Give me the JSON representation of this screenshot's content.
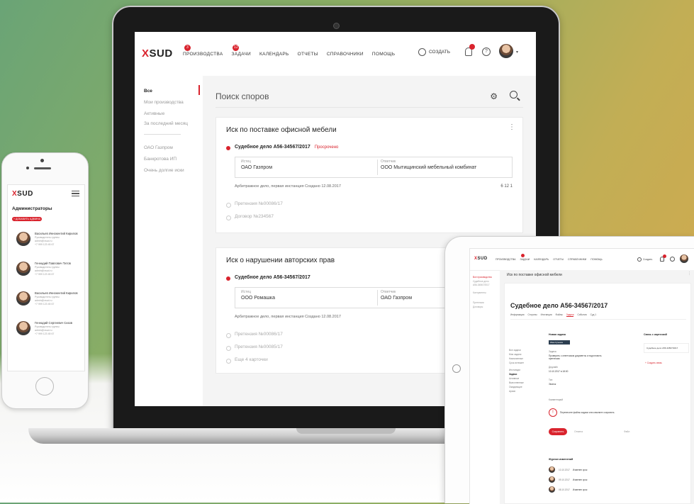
{
  "brand": {
    "logo_x": "X",
    "logo_rest": "SUD",
    "accent": "#d9232d"
  },
  "laptop": {
    "nav": [
      {
        "label": "ПРОИЗВОДСТВА",
        "badge": "3"
      },
      {
        "label": "ЗАДАЧИ",
        "badge": "12"
      },
      {
        "label": "КАЛЕНДАРЬ",
        "badge": ""
      },
      {
        "label": "ОТЧЕТЫ",
        "badge": ""
      },
      {
        "label": "СПРАВОЧНИКИ",
        "badge": ""
      },
      {
        "label": "ПОМОЩЬ",
        "badge": ""
      }
    ],
    "create_label": "СОЗДАТЬ",
    "help_glyph": "?",
    "sidebar": [
      "Все",
      "Мои производства",
      "Активные",
      "За последний месяц",
      "ОАО Газпром",
      "Банкротова ИП",
      "Очень долгие иски"
    ],
    "search_placeholder": "Поиск споров",
    "cards": [
      {
        "title": "Иск по поставке офисной мебели",
        "case": "Судебное дело А56-34567/2017",
        "status": "Просрочено",
        "plaintiff_label": "Истец",
        "plaintiff": "ОАО Газпром",
        "defendant_label": "Ответчик",
        "defendant": "ООО Мытищинский мебельный комбинат",
        "meta": "Арбитражное дело, первая инстанция   Создано 12.08.2017",
        "counts": "6   12   1",
        "linked": [
          "Претензия №00086/17",
          "Договор №234567"
        ]
      },
      {
        "title": "Иск о нарушении авторских прав",
        "case": "Судебное дело А56-34567/2017",
        "status": "",
        "plaintiff_label": "Истец",
        "plaintiff": "ООО Ромашка",
        "defendant_label": "Ответчик",
        "defendant": "ОАО Газпром",
        "meta": "Арбитражное дело, первая инстанция   Создано 12.08.2017",
        "counts": "",
        "linked": [
          "Претензия №00086/17",
          "Претензия №00085/17",
          "Еще 4 карточки"
        ]
      }
    ]
  },
  "phone": {
    "heading": "Администраторы",
    "button": "+ ДОБАВИТЬ АДМИНА",
    "people": [
      {
        "name": "Васильев Иннокентий Кирилов",
        "role": "Руководитель группы",
        "email": "admin@xsud.ru",
        "phone": "+7 999 123 45 67"
      },
      {
        "name": "Геннадий Павлович Титов",
        "role": "Руководитель группы",
        "email": "admin@xsud.ru",
        "phone": "+7 999 123 45 67"
      },
      {
        "name": "Васильев Иннокентий Кирилов",
        "role": "Руководитель группы",
        "email": "admin@xsud.ru",
        "phone": "+7 999 123 45 67"
      },
      {
        "name": "Геннадий Сергеевич Сизов",
        "role": "Руководитель группы",
        "email": "admin@xsud.ru",
        "phone": "+7 999 123 45 67"
      }
    ]
  },
  "tablet": {
    "nav": [
      "ПРОИЗВОДСТВА",
      "ЗАДАЧИ",
      "КАЛЕНДАРЬ",
      "ОТЧЕТЫ",
      "СПРАВОЧНИКИ",
      "ПОМОЩЬ"
    ],
    "create_label": "Создать",
    "sidebar": [
      "Все производства",
      "Судебное дело",
      "А56-34567/2017",
      "Контрагенты",
      "Претензии",
      "Договоры"
    ],
    "card_title": "Иск по поставке офисной мебели",
    "case_title": "Судебное дело А56-34567/2017",
    "tabs": [
      "Информация",
      "Стороны",
      "Инстанции",
      "Файлы",
      "Задачи",
      "События",
      "Суд 1"
    ],
    "new_task": "Новая задача",
    "links_title": "Связь с карточкой",
    "link_card": "Судебное дело А56-34567/2017",
    "add_link": "+ Создать связь",
    "left_labels": [
      "Все задачи",
      "Мои задачи",
      "Назначенные",
      "Срок истекает",
      "Инстанции",
      "Задачи",
      "Активные",
      "Выполненные",
      "Ожидающие",
      "Архив"
    ],
    "assignee": "Иван Кузьмин",
    "task_label": "Задача",
    "task_text": "Проверить с ответчиком документы и подготовить претензию",
    "deadline_label": "Дедлайн",
    "deadline": "10.10.2017 в 18:00",
    "type_label": "Тип",
    "type": "Звонок",
    "comment_label": "Комментарий",
    "warn": "Перенесите файлы задачи или кликните сохранить",
    "save": "Сохранить",
    "cancel": "Отмена",
    "attach": "Файл",
    "journal": "Журнал изменений",
    "log": [
      {
        "date": "10.10.2017",
        "text": "Изменен срок"
      },
      {
        "date": "09.10.2017",
        "text": "Изменен срок"
      },
      {
        "date": "08.10.2017",
        "text": "Изменен срок"
      }
    ]
  }
}
